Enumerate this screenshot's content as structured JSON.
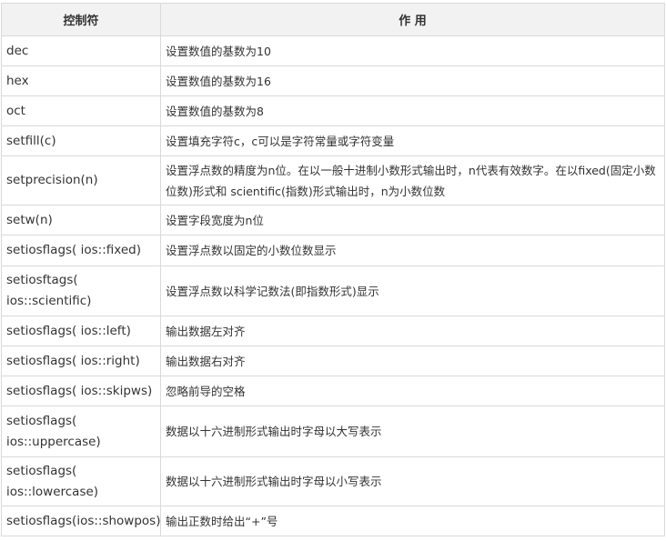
{
  "table": {
    "headers": [
      "控制符",
      "作 用"
    ],
    "rows": [
      {
        "control": "dec",
        "effect": "设置数值的基数为10"
      },
      {
        "control": "hex",
        "effect": "设置数值的基数为16"
      },
      {
        "control": "oct",
        "effect": "设置数值的基数为8"
      },
      {
        "control": "setfill(c)",
        "effect": "设置填充字符c，c可以是字符常量或字符变量"
      },
      {
        "control": "setprecision(n)",
        "effect": "设置浮点数的精度为n位。在以一般十进制小数形式输出时，n代表有效数字。在以fixed(固定小数位数)形式和 scientific(指数)形式输出时，n为小数位数"
      },
      {
        "control": "setw(n)",
        "effect": "设置字段宽度为n位"
      },
      {
        "control": "setiosflags( ios::fixed)",
        "effect": "设置浮点数以固定的小数位数显示"
      },
      {
        "control": "setiosftags( ios::scientific)",
        "effect": "设置浮点数以科学记数法(即指数形式)显示"
      },
      {
        "control": "setiosflags( ios::left)",
        "effect": "输出数据左对齐"
      },
      {
        "control": "setiosflags( ios::right)",
        "effect": "输出数据右对齐"
      },
      {
        "control": "setiosflags( ios::skipws)",
        "effect": "忽略前导的空格"
      },
      {
        "control": "setiosflags( ios::uppercase)",
        "effect": "数据以十六进制形式输出时字母以大写表示"
      },
      {
        "control": "setiosflags( ios::lowercase)",
        "effect": "数据以十六进制形式输出时字母以小写表示"
      },
      {
        "control": "setiosflags(ios::showpos)",
        "effect": "输出正数时给出“+”号"
      }
    ]
  }
}
